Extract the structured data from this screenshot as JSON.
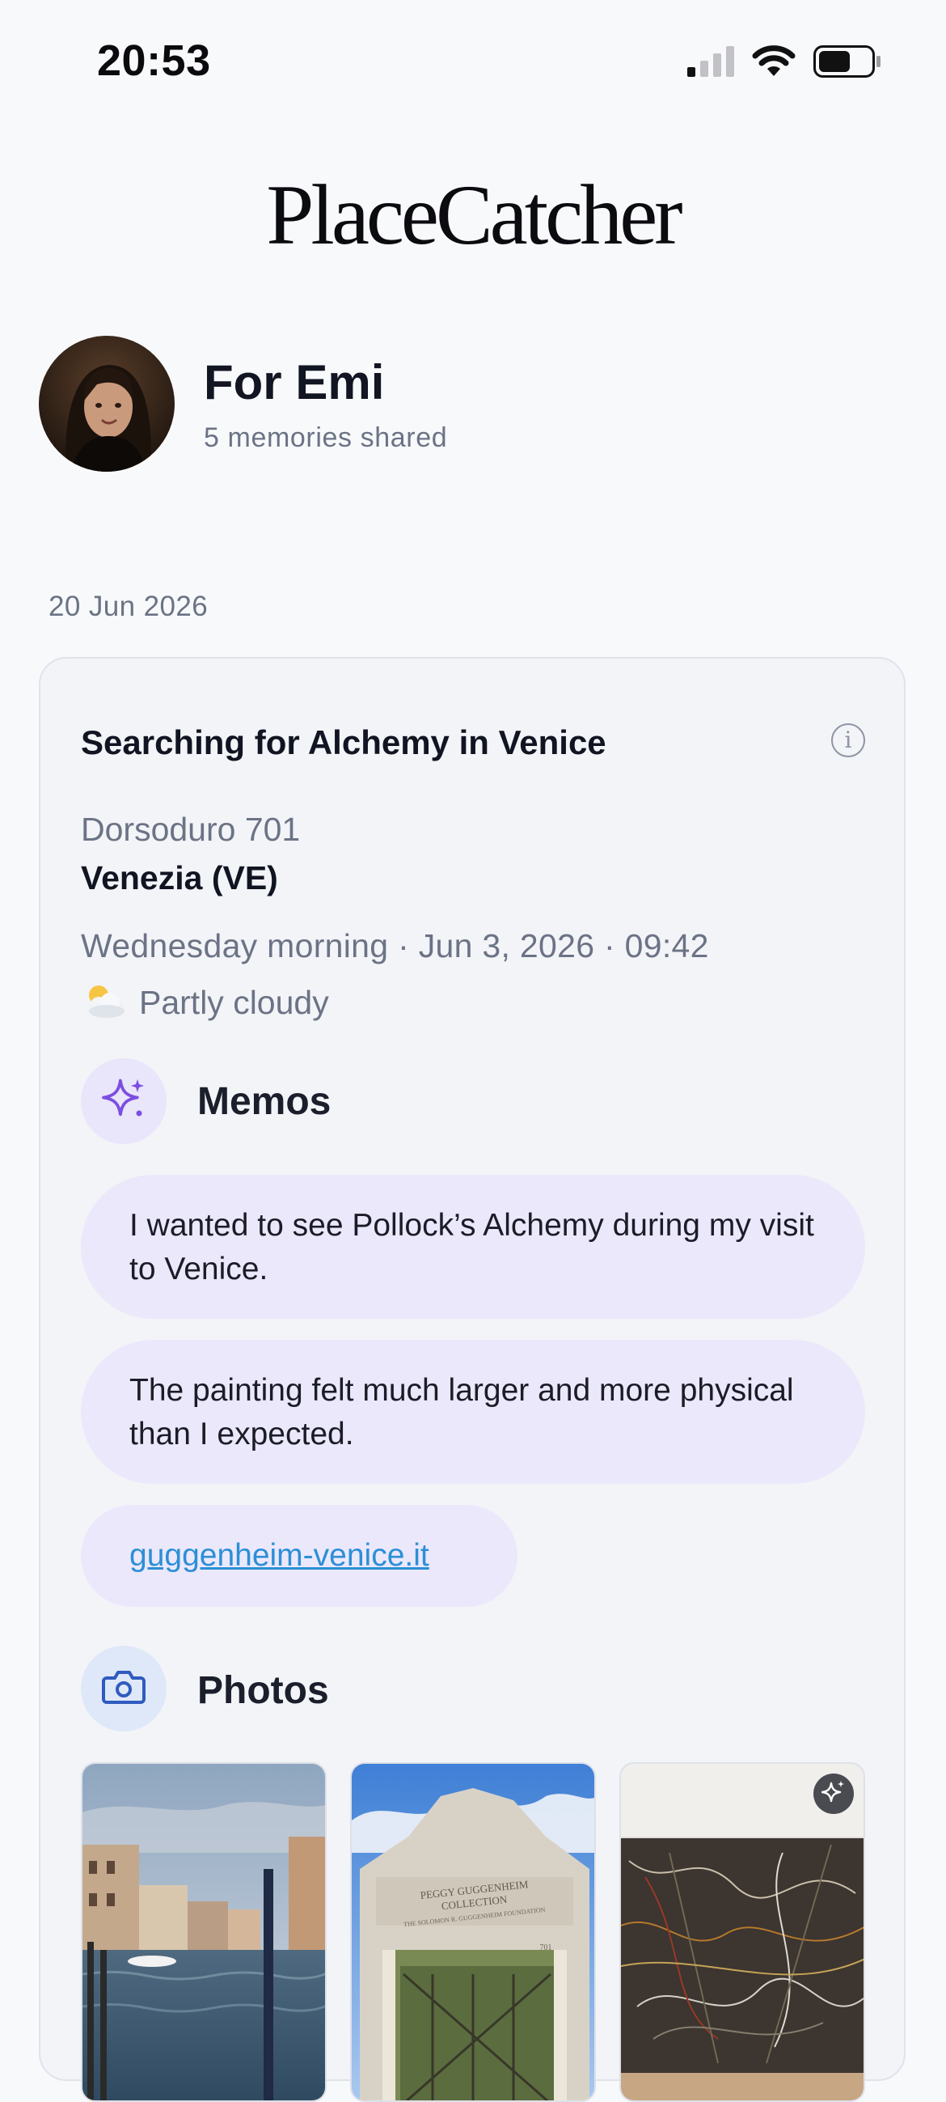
{
  "status_bar": {
    "time": "20:53"
  },
  "brand": {
    "logo_text": "PlaceCatcher"
  },
  "profile": {
    "name": "For Emi",
    "subtitle": "5 memories shared"
  },
  "feed": {
    "date_header": "20 Jun 2026"
  },
  "card": {
    "title": "Searching for Alchemy in Venice",
    "address": "Dorsoduro 701",
    "city": "Venezia (VE)",
    "datetime": "Wednesday morning · Jun 3, 2026 · 09:42",
    "weather_icon": "sun-behind-cloud",
    "weather_text": "Partly cloudy",
    "memos_section": {
      "title": "Memos",
      "icon": "sparkles-icon",
      "items": [
        "I wanted to see Pollock’s Alchemy during my visit to Venice.",
        "The painting felt much larger and more physical than I expected."
      ],
      "link": "guggenheim-venice.it"
    },
    "photos_section": {
      "title": "Photos",
      "icon": "camera-icon",
      "photos": [
        {
          "subject": "Grand Canal in Venice"
        },
        {
          "subject": "Peggy Guggenheim Collection gate",
          "gate_lines": [
            "PEGGY GUGGENHEIM",
            "COLLECTION",
            "THE SOLOMON R. GUGGENHEIM FOUNDATION",
            "701"
          ]
        },
        {
          "subject": "Pollock Alchemy painting",
          "badge": "ai-sparkle-icon"
        }
      ]
    }
  },
  "colors": {
    "background": "#f8f9fb",
    "card": "#f3f4f8",
    "memo_bubble": "#ebe8fb",
    "memo_icon_bg": "#ebe6fb",
    "memo_icon": "#7c4ee0",
    "photo_icon_bg": "#dfe8f8",
    "photo_icon": "#2f5bbf",
    "muted_text": "#6b7385",
    "link": "#2c8fd6"
  }
}
